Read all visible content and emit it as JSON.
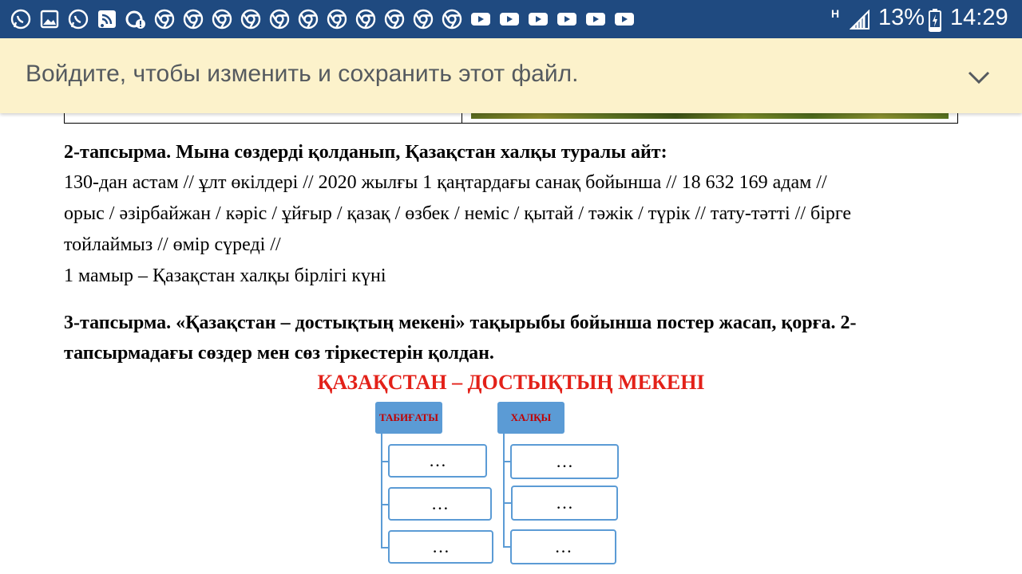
{
  "status_bar": {
    "notification_icons": [
      "whatsapp-icon",
      "gallery-icon",
      "whatsapp-icon",
      "wifi-icon",
      "settings-alert-icon",
      "chrome-icon",
      "chrome-icon",
      "chrome-icon",
      "chrome-icon",
      "chrome-icon",
      "chrome-icon",
      "chrome-icon",
      "chrome-icon",
      "chrome-icon",
      "chrome-icon",
      "youtube-icon",
      "youtube-icon",
      "youtube-icon",
      "youtube-icon",
      "youtube-icon",
      "youtube-icon"
    ],
    "network_type": "H",
    "battery_percent": "13%",
    "time": "14:29"
  },
  "banner": {
    "message": "Войдите, чтобы изменить и сохранить этот файл."
  },
  "document": {
    "task2_heading": "2-тапсырма. Мына сөздерді қолданып, Қазақстан халқы туралы айт:",
    "task2_line1": "130-дан астам // ұлт өкілдері // 2020 жылғы 1 қаңтардағы санақ бойынша // 18 632 169 адам //",
    "task2_line2": "орыс / әзірбайжан / кәріс / ұйғыр / қазақ / өзбек / неміс / қытай / тәжік / түрік // тату-тәтті // бірге",
    "task2_line3": "тойлаймыз // өмір сүреді //",
    "task2_line4": "1 мамыр – Қазақстан халқы бірлігі күні",
    "task3_line1": "3-тапсырма. «Қазақстан – достықтың мекені» тақырыбы бойынша постер жасап, қорға. 2-",
    "task3_line2": "тапсырмадағы сөздер мен сөз тіркестерін қолдан.",
    "poster_title": "ҚАЗАҚСТАН – ДОСТЫҚТЫҢ МЕКЕНІ",
    "diagram": {
      "left_header": "ТАБИҒАТЫ",
      "right_header": "ХАЛҚЫ",
      "left_items": [
        "…",
        "…",
        "…"
      ],
      "right_items": [
        "…",
        "…",
        "…"
      ]
    }
  },
  "colors": {
    "status_bar": "#1f4a80",
    "banner_bg": "#fcf2cb",
    "poster_title": "#e32119",
    "diagram_box": "#5b9bd5",
    "diagram_header_text": "#c00000"
  }
}
